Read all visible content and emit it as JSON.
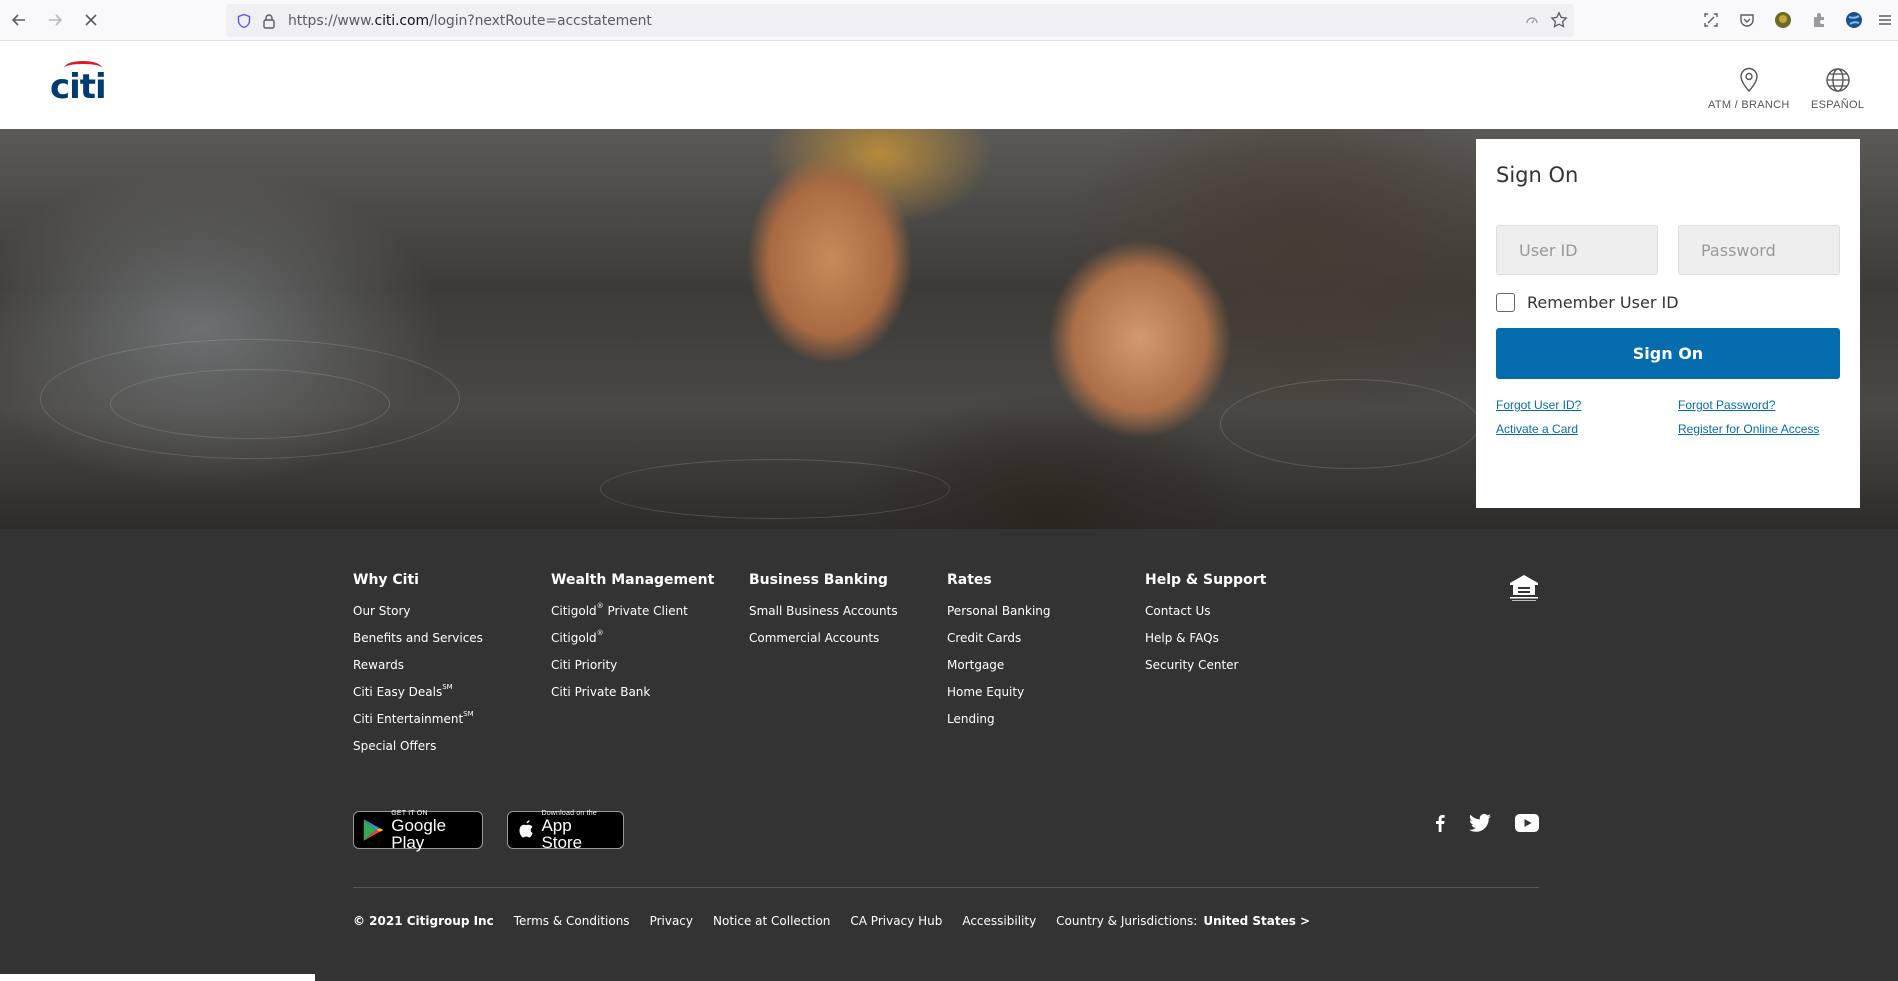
{
  "browser": {
    "url_prefix": "https://www.",
    "url_domain": "citi.com",
    "url_path": "/login?nextRoute=accstatement"
  },
  "header": {
    "logo_text": "citi",
    "atm_label": "ATM / BRANCH",
    "lang_label": "ESPAÑOL"
  },
  "signon": {
    "title": "Sign On",
    "user_placeholder": "User ID",
    "password_placeholder": "Password",
    "remember_label": "Remember User ID",
    "button_label": "Sign On",
    "forgot_user": "Forgot User ID?",
    "forgot_password": "Forgot Password?",
    "activate_card": "Activate a Card",
    "register": "Register for Online Access"
  },
  "footer": {
    "columns": [
      {
        "title": "Why Citi",
        "items": [
          "Our Story",
          "Benefits and Services",
          "Rewards",
          "Citi Easy Deals",
          "Citi Entertainment",
          "Special Offers"
        ]
      },
      {
        "title": "Wealth Management",
        "items": [
          "Citigold",
          "Private Client",
          "Citigold",
          "Citi Priority",
          "Citi Private Bank"
        ]
      },
      {
        "title": "Business Banking",
        "items": [
          "Small Business Accounts",
          "Commercial Accounts"
        ]
      },
      {
        "title": "Rates",
        "items": [
          "Personal Banking",
          "Credit Cards",
          "Mortgage",
          "Home Equity",
          "Lending"
        ]
      },
      {
        "title": "Help & Support",
        "items": [
          "Contact Us",
          "Help & FAQs",
          "Security Center"
        ]
      }
    ],
    "sup_sm": "SM",
    "sup_reg": "®",
    "google_small": "GET IT ON",
    "google_big": "Google Play",
    "apple_small": "Download on the",
    "apple_big": "App Store",
    "legal": {
      "copyright": "© 2021 Citigroup Inc",
      "terms": "Terms & Conditions",
      "privacy": "Privacy",
      "notice": "Notice at Collection",
      "ca_privacy": "CA Privacy Hub",
      "accessibility": "Accessibility",
      "country_label": "Country & Jurisdictions:",
      "country_value": "United States >"
    }
  },
  "colors": {
    "brand_blue": "#056dae",
    "logo_blue": "#003b70",
    "logo_red": "#d71e28",
    "footer_bg": "#333333"
  }
}
